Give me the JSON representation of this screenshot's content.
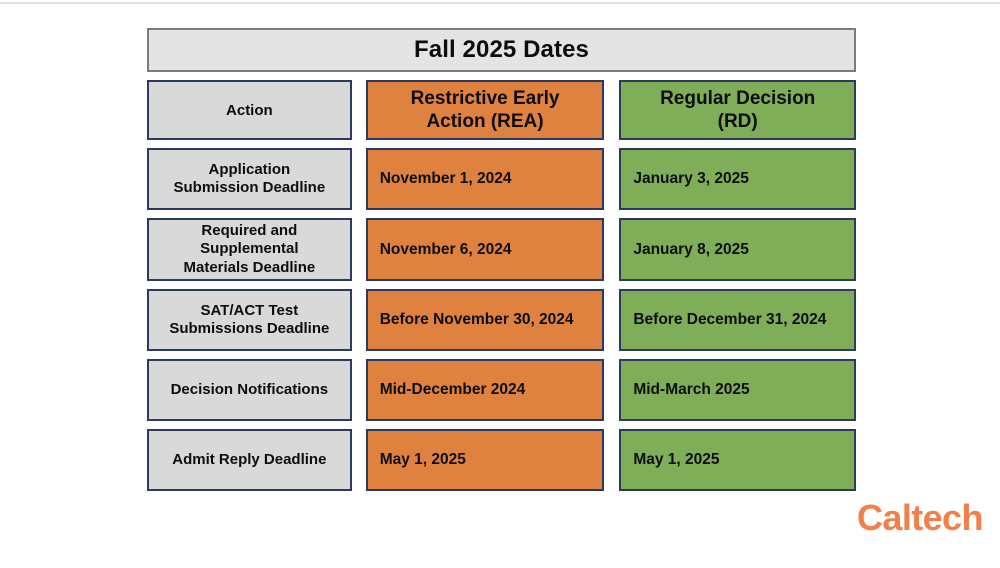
{
  "slide": {
    "title": "Fall 2025 Dates",
    "colors": {
      "header_banner_bg": "#e4e4e4",
      "header_banner_border": "#7b7b7b",
      "cell_border": "#2d3a5c",
      "action_column_bg": "#d9d9d9",
      "rea_column_bg": "#e0823f",
      "rd_column_bg": "#80ad58",
      "logo_orange": "#f2804a",
      "text": "#0d0d0d",
      "background": "#ffffff"
    }
  },
  "table": {
    "headers": {
      "action": "Action",
      "rea": "Restrictive Early Action (REA)",
      "rea_line1": "Restrictive Early",
      "rea_line2": "Action (REA)",
      "rd": "Regular Decision (RD)",
      "rd_line1": "Regular Decision",
      "rd_line2": "(RD)"
    },
    "rows": [
      {
        "action": "Application Submission Deadline",
        "action_line1": "Application",
        "action_line2": "Submission Deadline",
        "action_line3": "",
        "rea": "November 1, 2024",
        "rd": "January 3, 2025"
      },
      {
        "action": "Required and Supplemental Materials Deadline",
        "action_line1": "Required and",
        "action_line2": "Supplemental",
        "action_line3": "Materials Deadline",
        "rea": "November 6, 2024",
        "rd": "January 8, 2025"
      },
      {
        "action": "SAT/ACT Test Submissions Deadline",
        "action_line1": "SAT/ACT Test",
        "action_line2": "Submissions Deadline",
        "action_line3": "",
        "rea": "Before November 30, 2024",
        "rd": "Before December 31, 2024"
      },
      {
        "action": "Decision Notifications",
        "action_line1": "Decision Notifications",
        "action_line2": "",
        "action_line3": "",
        "rea": "Mid-December 2024",
        "rd": "Mid-March 2025"
      },
      {
        "action": "Admit Reply Deadline",
        "action_line1": "Admit Reply Deadline",
        "action_line2": "",
        "action_line3": "",
        "rea": "May 1, 2025",
        "rd": "May 1, 2025"
      }
    ]
  },
  "logo": {
    "text": "Caltech"
  }
}
